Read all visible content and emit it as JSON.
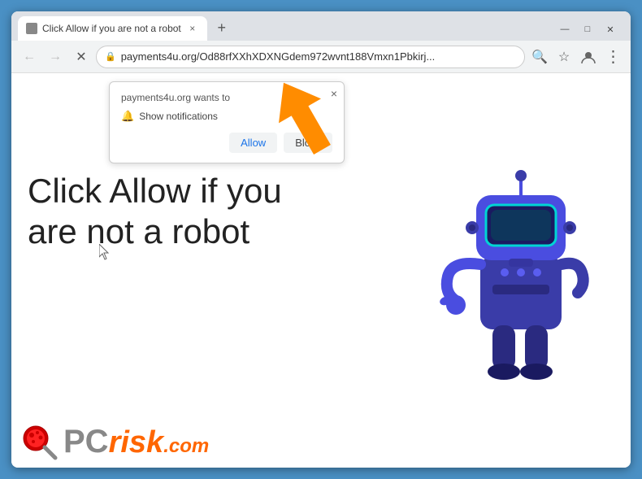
{
  "browser": {
    "tab": {
      "favicon_alt": "tab-favicon",
      "title": "Click Allow if you are not a robot",
      "close_label": "×"
    },
    "new_tab_label": "+",
    "window_controls": {
      "minimize": "—",
      "maximize": "□",
      "close": "✕"
    },
    "toolbar": {
      "back_label": "←",
      "forward_label": "→",
      "reload_label": "✕",
      "url": "payments4u.org/Od88rfXXhXDXNGdem972wvnt188Vmxn1Pbkirj...",
      "lock_icon": "🔒",
      "search_icon": "🔍",
      "bookmark_icon": "☆",
      "profile_icon": "👤",
      "menu_icon": "⋮",
      "download_icon": "⬇"
    },
    "notification_popup": {
      "site_text": "payments4u.org wants to",
      "notification_label": "Show notifications",
      "allow_label": "Allow",
      "block_label": "Block",
      "close_label": "×"
    }
  },
  "page": {
    "main_text": "Click Allow if you are not a robot",
    "pcrisk": {
      "pc_label": "PC",
      "risk_label": "risk",
      "com_label": ".com"
    }
  }
}
